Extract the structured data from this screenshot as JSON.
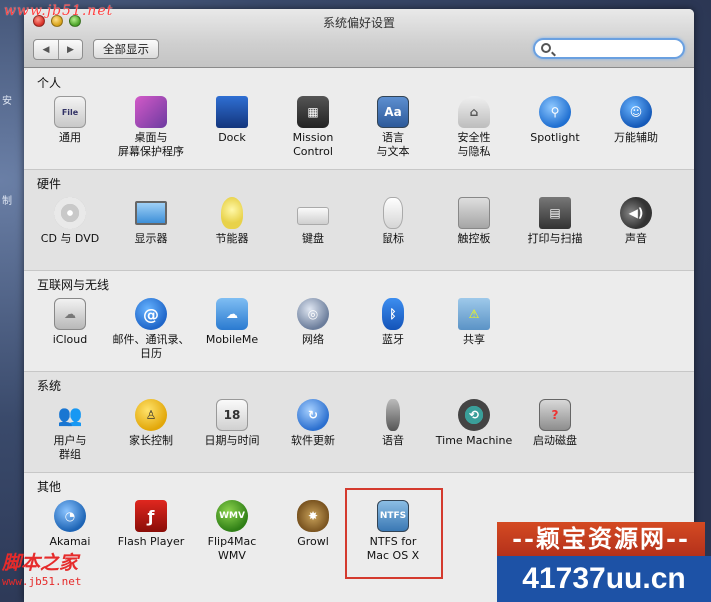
{
  "window": {
    "title": "系统偏好设置"
  },
  "toolbar": {
    "back_glyph": "◀",
    "forward_glyph": "▶",
    "show_all_label": "全部显示",
    "search_placeholder": ""
  },
  "desktop": {
    "fragment_1": "安",
    "fragment_2": "制"
  },
  "sections": {
    "personal": {
      "title": "个人",
      "items": [
        {
          "label": "通用",
          "icon": "general-icon",
          "glyph": "File"
        },
        {
          "label": "桌面与\n屏幕保护程序",
          "icon": "desktop-screensaver-icon",
          "glyph": ""
        },
        {
          "label": "Dock",
          "icon": "dock-icon",
          "glyph": ""
        },
        {
          "label": "Mission\nControl",
          "icon": "mission-control-icon",
          "glyph": "▦"
        },
        {
          "label": "语言\n与文本",
          "icon": "language-text-icon",
          "glyph": "Aa"
        },
        {
          "label": "安全性\n与隐私",
          "icon": "security-privacy-icon",
          "glyph": "⌂"
        },
        {
          "label": "Spotlight",
          "icon": "spotlight-icon",
          "glyph": "⚲"
        },
        {
          "label": "万能辅助",
          "icon": "universal-access-icon",
          "glyph": "☺"
        }
      ]
    },
    "hardware": {
      "title": "硬件",
      "items": [
        {
          "label": "CD 与 DVD",
          "icon": "cd-dvd-icon",
          "glyph": ""
        },
        {
          "label": "显示器",
          "icon": "displays-icon",
          "glyph": ""
        },
        {
          "label": "节能器",
          "icon": "energy-saver-icon",
          "glyph": ""
        },
        {
          "label": "键盘",
          "icon": "keyboard-icon",
          "glyph": ""
        },
        {
          "label": "鼠标",
          "icon": "mouse-icon",
          "glyph": ""
        },
        {
          "label": "触控板",
          "icon": "trackpad-icon",
          "glyph": ""
        },
        {
          "label": "打印与扫描",
          "icon": "print-scan-icon",
          "glyph": "▤"
        },
        {
          "label": "声音",
          "icon": "sound-icon",
          "glyph": "◀)"
        }
      ]
    },
    "internet": {
      "title": "互联网与无线",
      "items": [
        {
          "label": "iCloud",
          "icon": "icloud-icon",
          "glyph": "☁"
        },
        {
          "label": "邮件、通讯录、\n日历",
          "icon": "mail-contacts-calendars-icon",
          "glyph": "@"
        },
        {
          "label": "MobileMe",
          "icon": "mobileme-icon",
          "glyph": "☁"
        },
        {
          "label": "网络",
          "icon": "network-icon",
          "glyph": "◎"
        },
        {
          "label": "蓝牙",
          "icon": "bluetooth-icon",
          "glyph": "ᛒ"
        },
        {
          "label": "共享",
          "icon": "sharing-icon",
          "glyph": "⚠"
        }
      ]
    },
    "system": {
      "title": "系统",
      "items": [
        {
          "label": "用户与\n群组",
          "icon": "users-groups-icon",
          "glyph": "👥"
        },
        {
          "label": "家长控制",
          "icon": "parental-controls-icon",
          "glyph": "♙"
        },
        {
          "label": "日期与时间",
          "icon": "date-time-icon",
          "glyph": "18"
        },
        {
          "label": "软件更新",
          "icon": "software-update-icon",
          "glyph": "↻"
        },
        {
          "label": "语音",
          "icon": "speech-icon",
          "glyph": ""
        },
        {
          "label": "Time Machine",
          "icon": "time-machine-icon",
          "glyph": "⟲"
        },
        {
          "label": "启动磁盘",
          "icon": "startup-disk-icon",
          "glyph": "?"
        }
      ]
    },
    "other": {
      "title": "其他",
      "items": [
        {
          "label": "Akamai",
          "icon": "akamai-icon",
          "glyph": "◔"
        },
        {
          "label": "Flash Player",
          "icon": "flash-player-icon",
          "glyph": "ƒ"
        },
        {
          "label": "Flip4Mac\nWMV",
          "icon": "flip4mac-icon",
          "glyph": "WMV"
        },
        {
          "label": "Growl",
          "icon": "growl-icon",
          "glyph": "✸"
        },
        {
          "label": "NTFS for\nMac OS X",
          "icon": "ntfs-icon",
          "glyph": "NTFS"
        }
      ]
    }
  },
  "watermarks": {
    "top_left": "www.jb51.net",
    "bottom_left": "脚本之家",
    "bottom_left_url": "www.jb51.net",
    "right_banner": "--颖宝资源网--",
    "right_url": "41737uu.cn"
  },
  "colors": {
    "highlight_box": "#d43a2e",
    "search_focus": "#6aa0e0"
  }
}
